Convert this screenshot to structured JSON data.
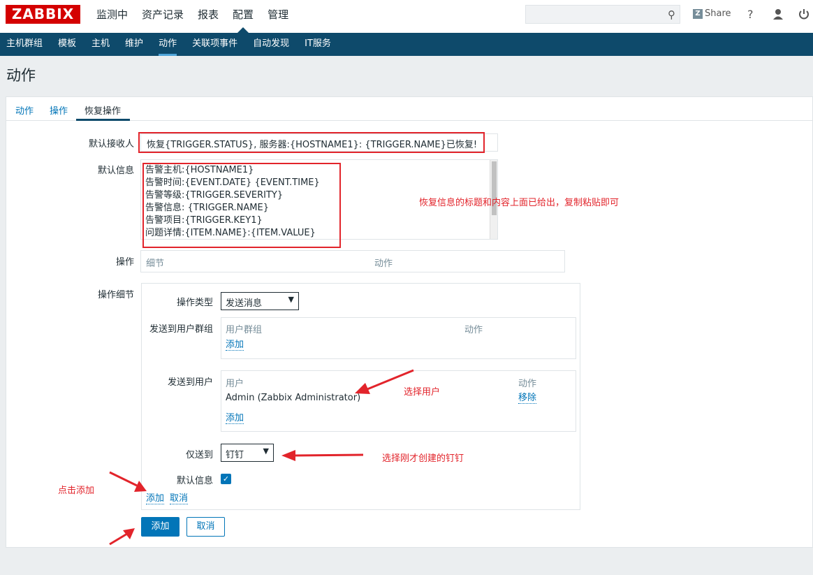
{
  "app": {
    "logo": "ZABBIX",
    "main_menu": [
      "监测中",
      "资产记录",
      "报表",
      "配置",
      "管理"
    ],
    "share_label": "Share",
    "help_label": "?"
  },
  "sub_menu": [
    "主机群组",
    "模板",
    "主机",
    "维护",
    "动作",
    "关联项事件",
    "自动发现",
    "IT服务"
  ],
  "page_title": "动作",
  "tabs": [
    "动作",
    "操作",
    "恢复操作"
  ],
  "form": {
    "default_recipient_label": "默认接收人",
    "default_recipient_value": "恢复{TRIGGER.STATUS}, 服务器:{HOSTNAME1}: {TRIGGER.NAME}已恢复!",
    "default_message_label": "默认信息",
    "default_message_lines": [
      "告警主机:{HOSTNAME1}",
      "告警时间:{EVENT.DATE} {EVENT.TIME}",
      "告警等级:{TRIGGER.SEVERITY}",
      "告警信息: {TRIGGER.NAME}",
      "告警项目:{TRIGGER.KEY1}",
      "问题详情:{ITEM.NAME}:{ITEM.VALUE}"
    ],
    "operations_label": "操作",
    "operations_headers": [
      "细节",
      "动作"
    ],
    "operation_details_label": "操作细节",
    "operation_type_label": "操作类型",
    "operation_type_value": "发送消息",
    "send_to_groups_label": "发送到用户群组",
    "groups_headers": [
      "用户群组",
      "动作"
    ],
    "groups_add": "添加",
    "send_to_users_label": "发送到用户",
    "users_headers": [
      "用户",
      "动作"
    ],
    "user_row": "Admin (Zabbix Administrator)",
    "user_remove": "移除",
    "users_add": "添加",
    "send_only_to_label": "仅送到",
    "send_only_to_value": "钉钉",
    "default_message_check_label": "默认信息",
    "detail_add": "添加",
    "detail_cancel": "取消",
    "add_button": "添加",
    "cancel_button": "取消"
  },
  "annotations": {
    "copy_hint": "恢复信息的标题和内容上面已给出，复制粘贴即可",
    "select_user": "选择用户",
    "select_dingtalk": "选择刚才创建的钉钉",
    "click_add": "点击添加"
  },
  "colors": {
    "brand_red": "#d40000",
    "nav_blue": "#0e4a6b",
    "link_blue": "#0275b8",
    "annotation_red": "#e2242b"
  }
}
